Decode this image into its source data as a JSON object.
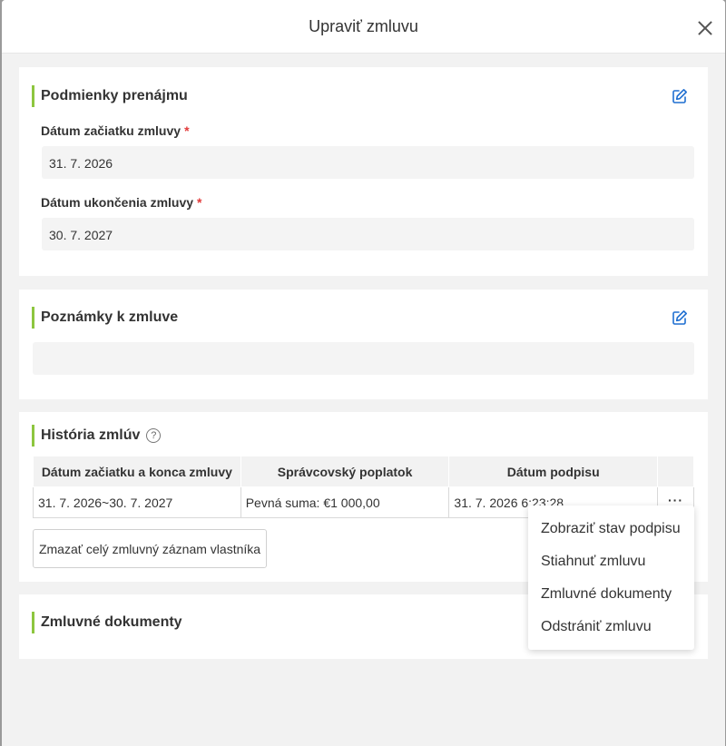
{
  "modal": {
    "title": "Upraviť zmluvu"
  },
  "rental_terms": {
    "title": "Podmienky prenájmu",
    "start_label": "Dátum začiatku zmluvy",
    "start_value": "31. 7. 2026",
    "end_label": "Dátum ukončenia zmluvy",
    "end_value": "30. 7. 2027",
    "required_mark": "*"
  },
  "notes": {
    "title": "Poznámky k zmluve",
    "value": ""
  },
  "history": {
    "title": "História zmlúv",
    "help": "?",
    "columns": [
      "Dátum začiatku a konca zmluvy",
      "Správcovský poplatok",
      "Dátum podpisu",
      ""
    ],
    "rows": [
      {
        "period": "31. 7. 2026~30. 7. 2027",
        "fee": "Pevná suma: €1 000,00",
        "signed": "31. 7. 2026 6:23:28",
        "more": "···"
      }
    ],
    "delete_label": "Zmazať celý zmluvný záznam vlastníka"
  },
  "documents": {
    "title": "Zmluvné dokumenty"
  },
  "context_menu": {
    "items": [
      "Zobraziť stav podpisu",
      "Stiahnuť zmluvu",
      "Zmluvné dokumenty",
      "Odstrániť zmluvu"
    ]
  },
  "colors": {
    "accent_bar": "#8dc63f",
    "edit_icon": "#1f6fd1",
    "required": "#e23a3a"
  }
}
